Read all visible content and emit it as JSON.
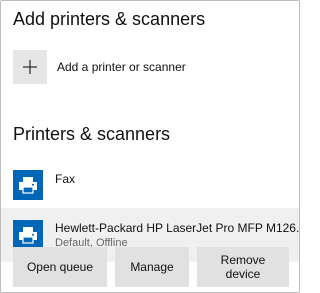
{
  "add_section": {
    "title": "Add printers & scanners",
    "add_label": "Add a printer or scanner"
  },
  "printers_section": {
    "title": "Printers & scanners",
    "items": [
      {
        "name": "Fax",
        "status": ""
      },
      {
        "name": "Hewlett-Packard HP LaserJet Pro MFP M126...",
        "status": "Default, Offline"
      }
    ]
  },
  "actions": {
    "open_queue": "Open queue",
    "manage": "Manage",
    "remove_device": "Remove device"
  },
  "colors": {
    "printer_icon_bg": "#0067b8",
    "selected_row_bg": "#f0f0f0",
    "button_bg": "#e1e1e1"
  },
  "icons": {
    "add": "plus-icon",
    "printer": "printer-icon"
  }
}
